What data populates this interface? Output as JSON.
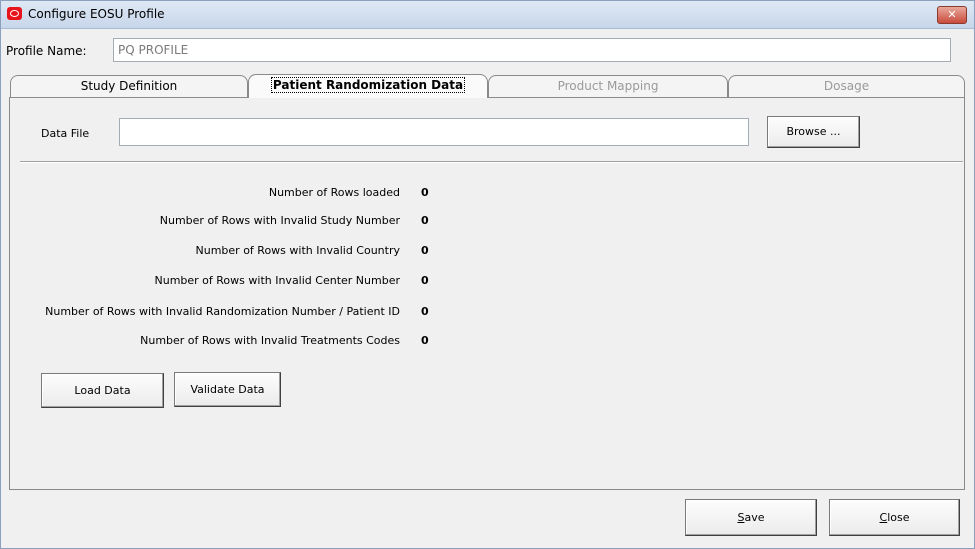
{
  "window": {
    "title": "Configure EOSU Profile",
    "close_glyph": "✕"
  },
  "profile": {
    "label": "Profile Name:",
    "value": "PQ PROFILE"
  },
  "tabs": [
    {
      "label": "Study Definition",
      "state": "normal"
    },
    {
      "label": "Patient Randomization Data",
      "state": "selected"
    },
    {
      "label": "Product Mapping",
      "state": "disabled"
    },
    {
      "label": "Dosage",
      "state": "disabled"
    }
  ],
  "datafile": {
    "label": "Data File",
    "value": "",
    "browse_label": "Browse ..."
  },
  "stats": [
    {
      "label": "Number of Rows loaded",
      "value": "0"
    },
    {
      "label": "Number of Rows with Invalid Study Number",
      "value": "0"
    },
    {
      "label": "Number of Rows with Invalid Country",
      "value": "0"
    },
    {
      "label": "Number of Rows with Invalid Center Number",
      "value": "0"
    },
    {
      "label": "Number of Rows with Invalid Randomization Number / Patient ID",
      "value": "0"
    },
    {
      "label": "Number of Rows with Invalid Treatments Codes",
      "value": "0"
    }
  ],
  "actions": {
    "load_label": "Load Data",
    "validate_label": "Validate Data"
  },
  "footer": {
    "save_mnemonic": "S",
    "save_rest": "ave",
    "close_mnemonic": "C",
    "close_rest": "lose"
  },
  "colors": {
    "app_icon": "#e8141b",
    "close_button": "#c94b3c"
  }
}
